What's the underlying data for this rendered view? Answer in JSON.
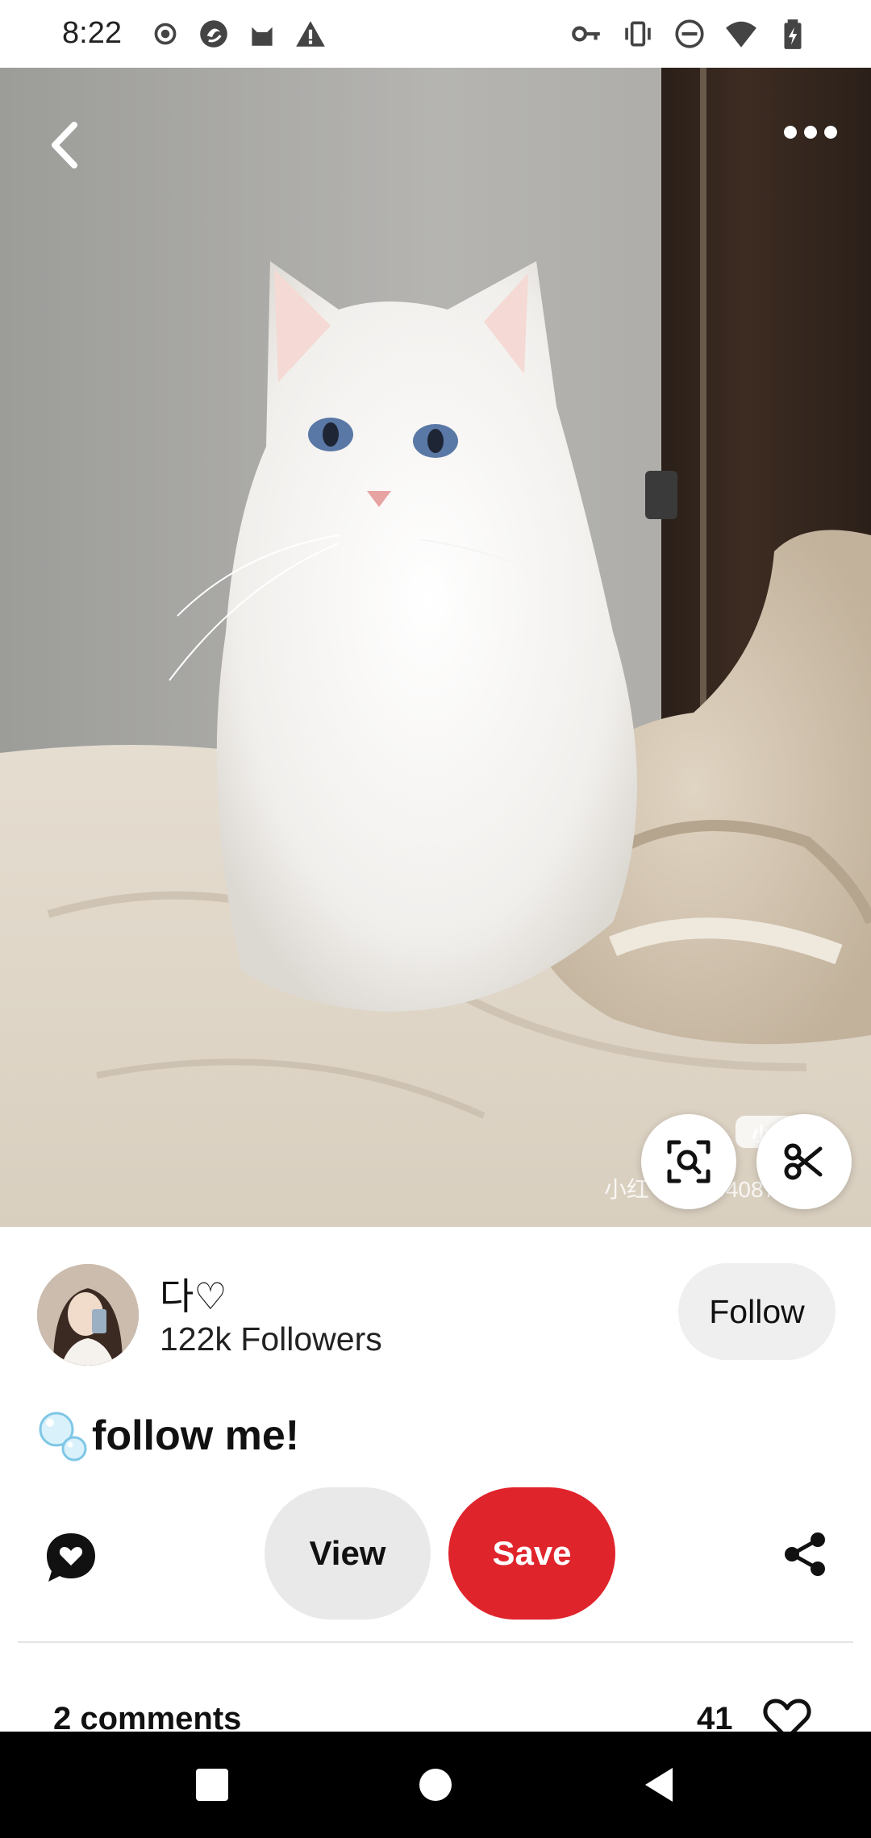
{
  "status_bar": {
    "time": "8:22",
    "left_icons": [
      "record-icon",
      "app-icon",
      "cat-icon",
      "warning-icon"
    ],
    "right_icons": [
      "vpn-key-icon",
      "vibrate-icon",
      "do-not-disturb-icon",
      "wifi-icon",
      "battery-charging-icon"
    ]
  },
  "hero": {
    "watermark": "小红书 ID: 9408760003",
    "watermark_badge": "小红书",
    "buttons": [
      "back-icon",
      "more-icon",
      "visual-search-icon",
      "scissors-icon"
    ]
  },
  "profile": {
    "name": "다♡",
    "followers": "122k Followers",
    "follow_label": "Follow"
  },
  "pin": {
    "title_emoji": "bubbles-icon",
    "title": "follow me!"
  },
  "actions": {
    "view_label": "View",
    "save_label": "Save",
    "icons": [
      "comment-heart-icon",
      "share-icon"
    ]
  },
  "comments": {
    "count_label": "2 comments",
    "likes": "41"
  },
  "nav": {
    "icons": [
      "recents-icon",
      "home-icon",
      "back-icon"
    ]
  },
  "colors": {
    "save": "#e0242c",
    "view": "#e9e9e9",
    "follow": "#efefef"
  }
}
